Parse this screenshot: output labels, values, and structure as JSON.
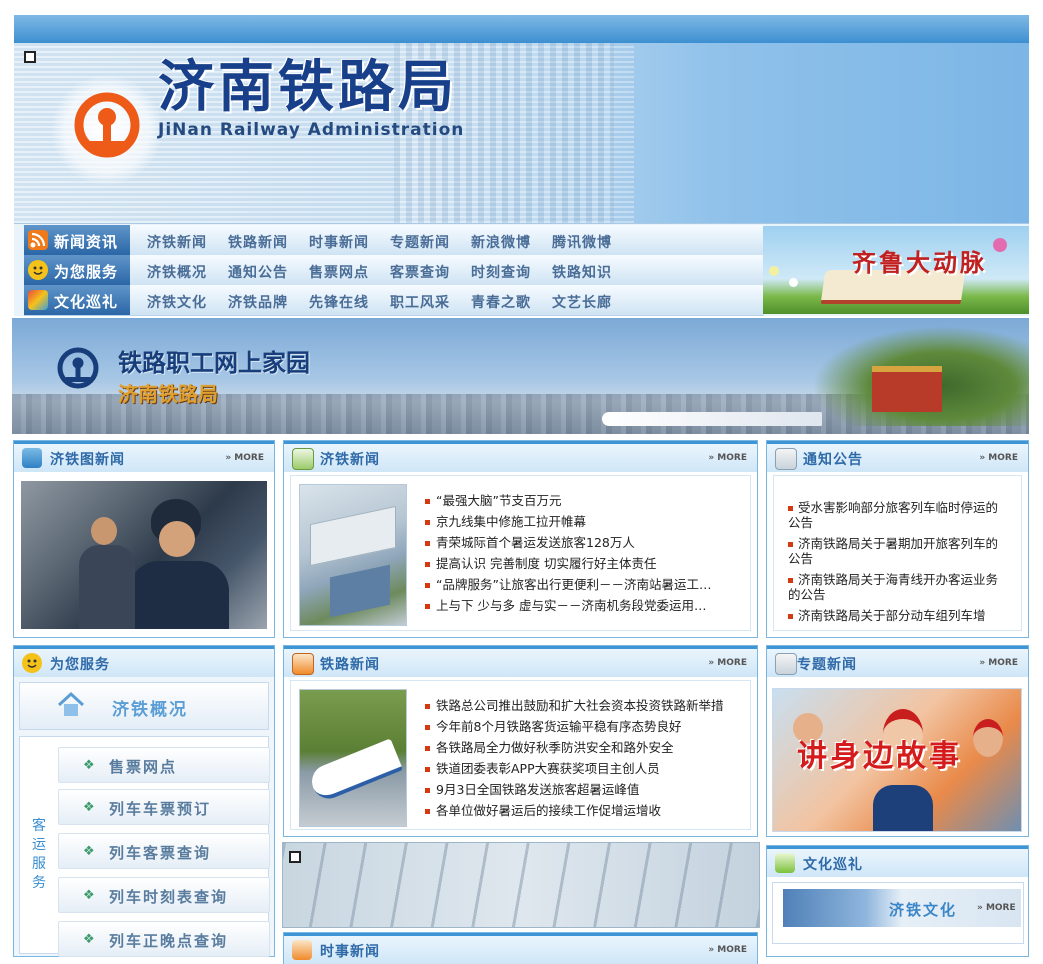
{
  "header": {
    "title": "济南铁路局",
    "subtitle": "JiNan Railway Administration"
  },
  "nav": {
    "rows": [
      {
        "label": "新闻资讯",
        "icon": "rss-icon",
        "links": [
          "济铁新闻",
          "铁路新闻",
          "时事新闻",
          "专题新闻",
          "新浪微博",
          "腾讯微博"
        ]
      },
      {
        "label": "为您服务",
        "icon": "smiley-icon",
        "links": [
          "济铁概况",
          "通知公告",
          "售票网点",
          "客票查询",
          "时刻查询",
          "铁路知识"
        ]
      },
      {
        "label": "文化巡礼",
        "icon": "fan-icon",
        "links": [
          "济铁文化",
          "济铁品牌",
          "先锋在线",
          "职工风采",
          "青春之歌",
          "文艺长廊"
        ]
      }
    ],
    "side_banner": "齐鲁大动脉"
  },
  "home_banner": {
    "title": "铁路职工网上家园",
    "subtitle": "济南铁路局"
  },
  "more_label": "» MORE",
  "panels": {
    "photo_news": {
      "title": "济铁图新闻"
    },
    "jitie_news": {
      "title": "济铁新闻",
      "items": [
        "“最强大脑”节支百万元",
        "京九线集中修施工拉开帷幕",
        "青荣城际首个暑运发送旅客128万人",
        "提高认识  完善制度  切实履行好主体责任",
        "“品牌服务”让旅客出行更便利－－济南站暑运工…",
        "上与下  少与多  虚与实－－济南机务段党委运用…"
      ]
    },
    "notices": {
      "title": "通知公告",
      "items": [
        "受水害影响部分旅客列车临时停运的公告",
        "济南铁路局关于暑期加开旅客列车的公告",
        "济南铁路局关于海青线开办客运业务的公告",
        "济南铁路局关于部分动车组列车增"
      ]
    },
    "services": {
      "title": "为您服务",
      "overview": "济铁概况",
      "vertical_label": "客运服务",
      "buttons": [
        "售票网点",
        "列车车票预订",
        "列车客票查询",
        "列车时刻表查询",
        "列车正晚点查询"
      ]
    },
    "railway_news": {
      "title": "铁路新闻",
      "items": [
        "铁路总公司推出鼓励和扩大社会资本投资铁路新举措",
        "今年前8个月铁路客货运输平稳有序态势良好",
        "各铁路局全力做好秋季防洪安全和路外安全",
        "铁道团委表彰APP大赛获奖项目主创人员",
        "9月3日全国铁路发送旅客超暑运峰值",
        "各单位做好暑运后的接续工作促增运增收"
      ]
    },
    "special_news": {
      "title": "专题新闻",
      "banner": "讲身边故事"
    },
    "culture": {
      "title": "文化巡礼",
      "item": "济铁文化"
    },
    "current_news": {
      "title": "时事新闻"
    }
  }
}
